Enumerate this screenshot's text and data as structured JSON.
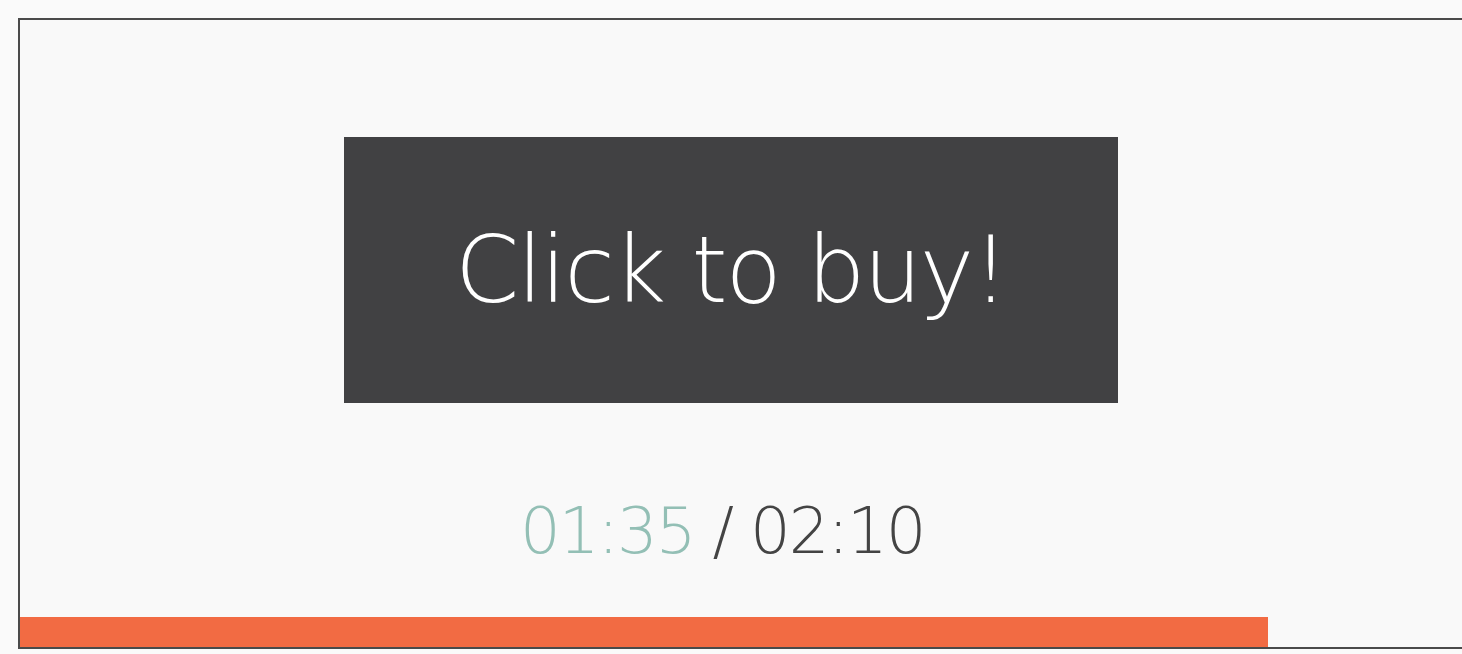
{
  "buy_button": {
    "label": "Click to buy!"
  },
  "timer": {
    "current": "01:35",
    "separator": "/",
    "total": "02:10"
  },
  "progress": {
    "level": 0.856
  }
}
